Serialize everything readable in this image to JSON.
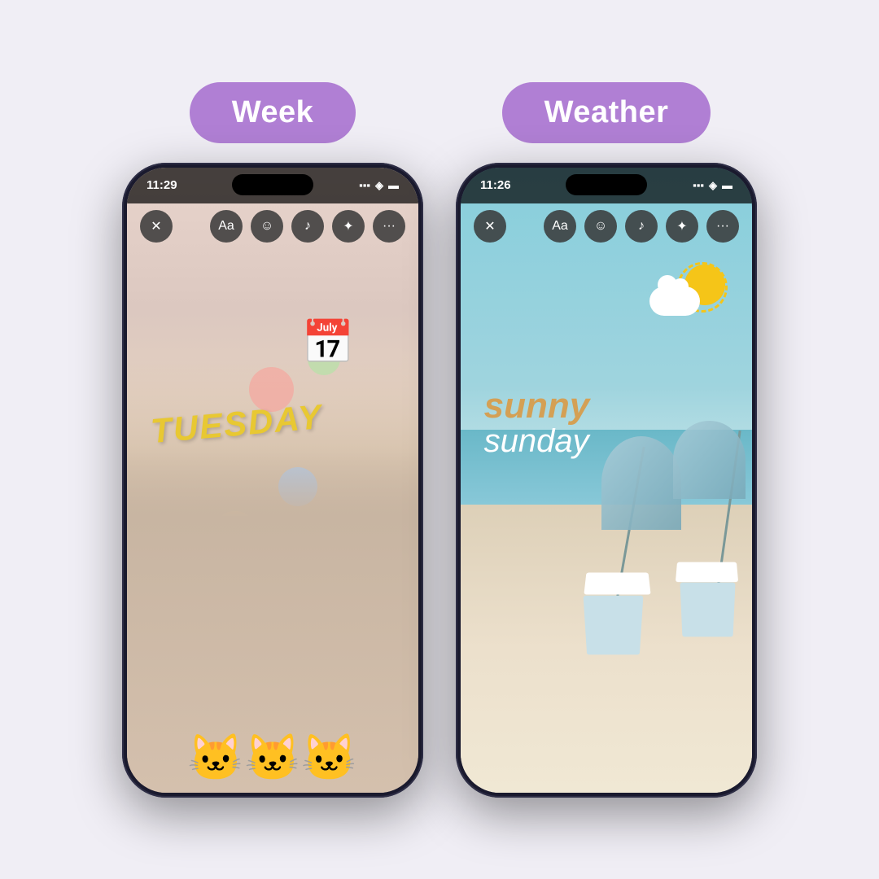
{
  "background_color": "#f0eef5",
  "left_section": {
    "label": "Week",
    "label_bg": "#b07fd4",
    "phone": {
      "time": "11:29",
      "status_icons": "▲▲ ◈ ▪",
      "content": {
        "day_text": "TuEsDAY",
        "day_text_color": "#e8c832",
        "sticker": "📅"
      }
    }
  },
  "right_section": {
    "label": "Weather",
    "label_bg": "#b07fd4",
    "phone": {
      "time": "11:26",
      "status_icons": "▲▲ ◈ ▪",
      "content": {
        "line1": "sunny",
        "line2": "sunday",
        "line1_color": "#d4a055",
        "line2_color": "#ffffff"
      }
    }
  },
  "toolbar_buttons": [
    "✕",
    "Aa",
    "☺",
    "♪",
    "✦",
    "···"
  ]
}
